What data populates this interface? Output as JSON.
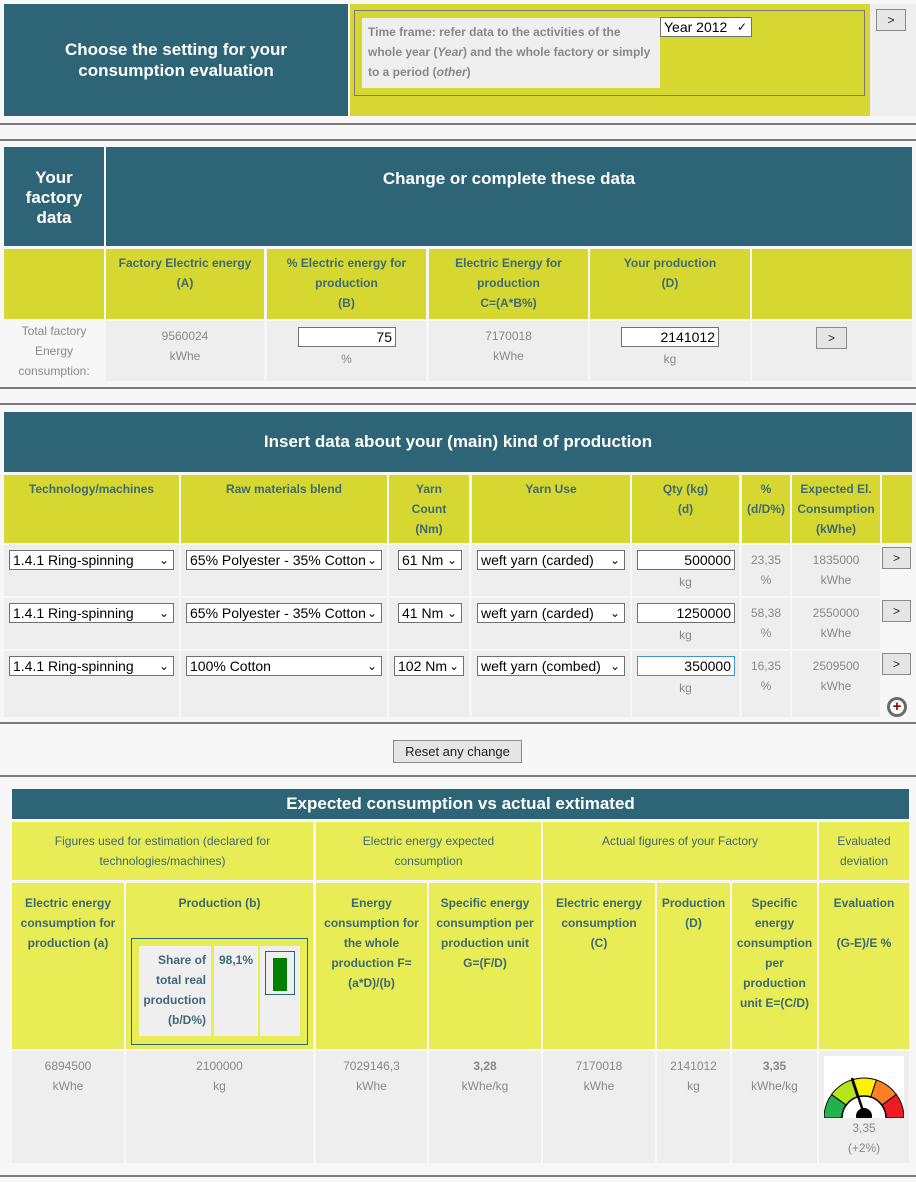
{
  "settings": {
    "title": "Choose the setting for your consumption evaluation",
    "timeframe_text_1": "Time frame: refer data to the activities of the whole year (",
    "timeframe_em_1": "Year",
    "timeframe_text_2": ") and the whole factory or simply to a period (",
    "timeframe_em_2": "other",
    "timeframe_text_3": ")",
    "timeframe_select": "Year 2012",
    "go_label": ">"
  },
  "factory": {
    "side_title": "Your factory data",
    "header": "Change or complete these data",
    "columns": [
      {
        "label": "Factory Electric energy",
        "sub": "(A)"
      },
      {
        "label": "% Electric energy for production",
        "sub": "(B)"
      },
      {
        "label": "Electric Energy for production",
        "sub": "C=(A*B%)"
      },
      {
        "label": "Your production",
        "sub": "(D)"
      }
    ],
    "row_label": "Total factory Energy consumption:",
    "energy_value": "9560024",
    "energy_unit": "kWhe",
    "percent_value": "75",
    "percent_unit": "%",
    "prod_energy_value": "7170018",
    "prod_energy_unit": "kWhe",
    "production_value": "2141012",
    "production_unit": "kg",
    "go_label": ">"
  },
  "production": {
    "header": "Insert data about your (main) kind of production",
    "columns": [
      "Technology/machines",
      "Raw materials blend",
      "Yarn Count (Nm)",
      "Yarn Use",
      "Qty (kg) (d)",
      "% (d/D%)",
      "Expected El. Consumption (kWhe)"
    ],
    "rows": [
      {
        "tech": "1.4.1 Ring-spinning",
        "blend": "65% Polyester - 35% Cotton",
        "count": "61 Nm",
        "use": "weft yarn (carded)",
        "qty": "500000",
        "qty_unit": "kg",
        "pct": "23,35",
        "pct_unit": "%",
        "expected": "1835000",
        "expected_unit": "kWhe",
        "go": ">"
      },
      {
        "tech": "1.4.1 Ring-spinning",
        "blend": "65% Polyester - 35% Cotton",
        "count": "41 Nm",
        "use": "weft yarn (carded)",
        "qty": "1250000",
        "qty_unit": "kg",
        "pct": "58,38",
        "pct_unit": "%",
        "expected": "2550000",
        "expected_unit": "kWhe",
        "go": ">"
      },
      {
        "tech": "1.4.1 Ring-spinning",
        "blend": "100% Cotton",
        "count": "102 Nm",
        "use": "weft yarn (combed)",
        "qty": "350000",
        "qty_unit": "kg",
        "pct": "16,35",
        "pct_unit": "%",
        "expected": "2509500",
        "expected_unit": "kWhe",
        "go": ">"
      }
    ],
    "add_icon": "plus-circle-icon",
    "reset_label": "Reset any change"
  },
  "summary": {
    "header": "Expected consumption vs actual extimated",
    "groups": [
      "Figures used for estimation (declared for technologies/machines)",
      "Electric energy expected consumption",
      "Actual figures of your Factory",
      "Evaluated deviation"
    ],
    "columns": [
      "Electric energy consumption for production (a)",
      "Production (b)",
      "Energy consumption for the whole production F=(a*D)/(b)",
      "Specific energy consumption per production unit G=(F/D)",
      "Electric energy consumption (C)",
      "Production (D)",
      "Specific energy consumption per production unit E=(C/D)",
      "Evaluation"
    ],
    "evaluation_formula": "(G-E)/E %",
    "share_label": "Share of total real production (b/D%)",
    "share_value": "98,1%",
    "share_fraction": 0.981,
    "values": {
      "a": "6894500",
      "a_unit": "kWhe",
      "b": "2100000",
      "b_unit": "kg",
      "f": "7029146,3",
      "f_unit": "kWhe",
      "g": "3,28",
      "g_unit": "kWhe/kg",
      "c": "7170018",
      "c_unit": "kWhe",
      "d": "2141012",
      "d_unit": "kg",
      "e": "3,35",
      "e_unit": "kWhe/kg",
      "eval_value": "3,35",
      "eval_deviation": "(+2%)"
    },
    "gauge_colors": [
      "#22b14c",
      "#b5e61d",
      "#fff200",
      "#ff7f27",
      "#ed1c24"
    ]
  }
}
